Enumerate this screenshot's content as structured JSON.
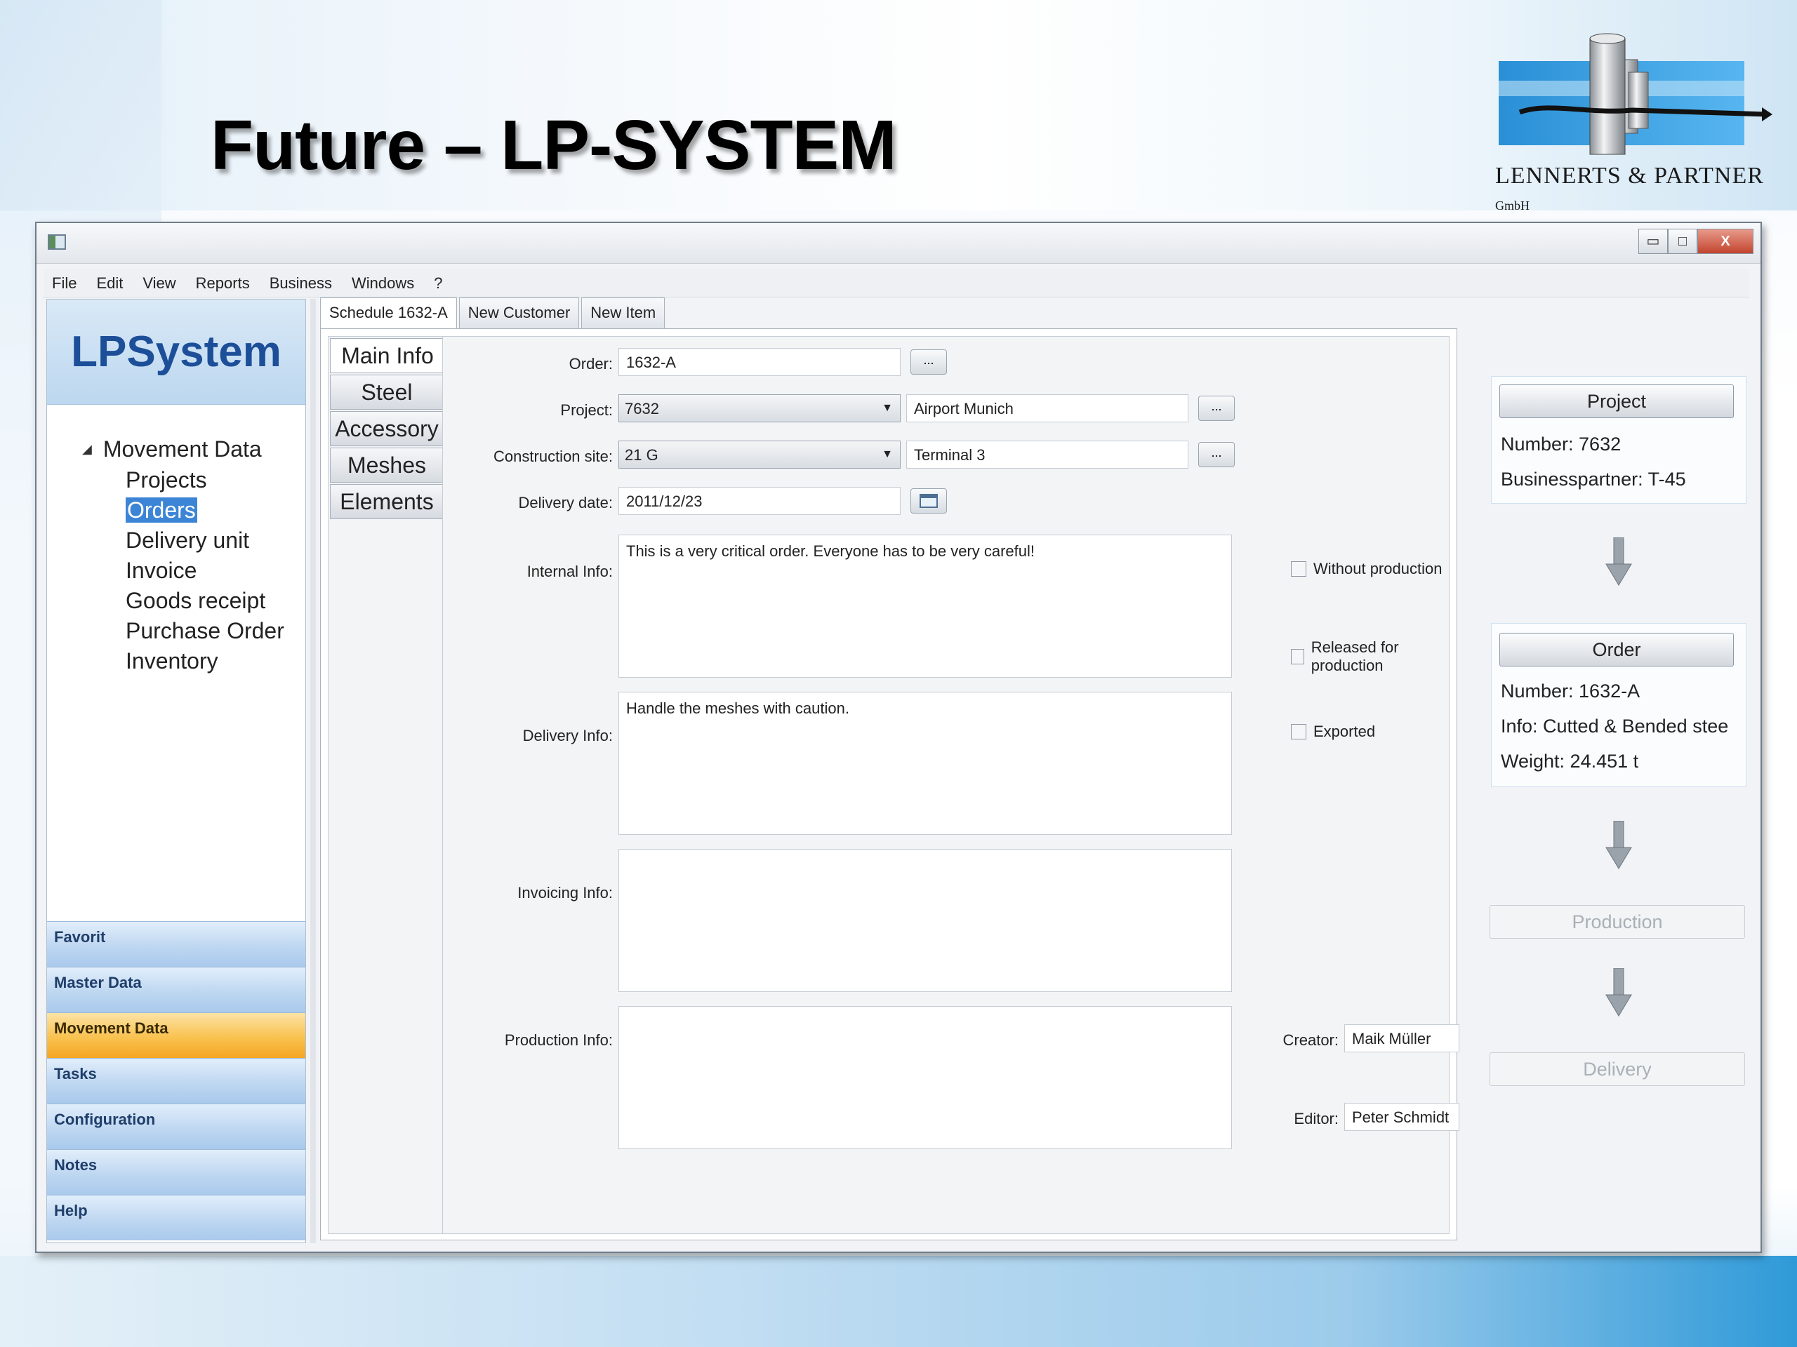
{
  "slide": {
    "title": "Future – LP-SYSTEM",
    "logo_text": "LENNERTS & PARTNER",
    "logo_suffix": "GmbH"
  },
  "window": {
    "controls": {
      "minimize": "▭",
      "maximize": "□",
      "close": "X"
    }
  },
  "menubar": [
    "File",
    "Edit",
    "View",
    "Reports",
    "Business",
    "Windows",
    "?"
  ],
  "sidebar": {
    "brand": "LPSystem",
    "tree": {
      "root": "Movement Data",
      "items": [
        "Projects",
        "Orders",
        "Delivery unit",
        "Invoice",
        "Goods receipt",
        "Purchase Order",
        "Inventory"
      ],
      "selected": "Orders"
    },
    "nav": [
      "Favorit",
      "Master Data",
      "Movement Data",
      "Tasks",
      "Configuration",
      "Notes",
      "Help"
    ],
    "nav_active": "Movement Data"
  },
  "doc_tabs": [
    "Schedule 1632-A",
    "New Customer",
    "New Item"
  ],
  "side_tabs": [
    "Main Info",
    "Steel",
    "Accessory",
    "Meshes",
    "Elements"
  ],
  "form": {
    "order_label": "Order:",
    "order_value": "1632-A",
    "project_label": "Project:",
    "project_value": "7632",
    "project_name": "Airport Munich",
    "site_label": "Construction site:",
    "site_value": "21 G",
    "site_name": "Terminal 3",
    "delivery_date_label": "Delivery date:",
    "delivery_date_value": "2011/12/23",
    "dots": "...",
    "internal_info_label": "Internal Info:",
    "internal_info_value": "This is a very critical order. Everyone has to be very careful!",
    "delivery_info_label": "Delivery Info:",
    "delivery_info_value": "Handle the meshes with caution.",
    "invoicing_info_label": "Invoicing Info:",
    "invoicing_info_value": "",
    "production_info_label": "Production Info:",
    "production_info_value": "",
    "checkboxes": {
      "without_production": "Without production",
      "released": "Released for production",
      "exported": "Exported"
    },
    "creator_label": "Creator:",
    "creator_value": "Maik Müller",
    "editor_label": "Editor:",
    "editor_value": "Peter Schmidt"
  },
  "workflow": {
    "project_button": "Project",
    "project_number": "Number: 7632",
    "project_partner": "Businesspartner: T-45",
    "order_button": "Order",
    "order_number": "Number: 1632-A",
    "order_info": "Info: Cutted & Bended stee",
    "order_weight": "Weight: 24.451 t",
    "production_button": "Production",
    "delivery_button": "Delivery"
  },
  "colors": {
    "accent": "#3c85d6",
    "brand_text": "#1d4f99",
    "nav_active": "#f9c24f",
    "nav_idle": "#bed7f1"
  }
}
